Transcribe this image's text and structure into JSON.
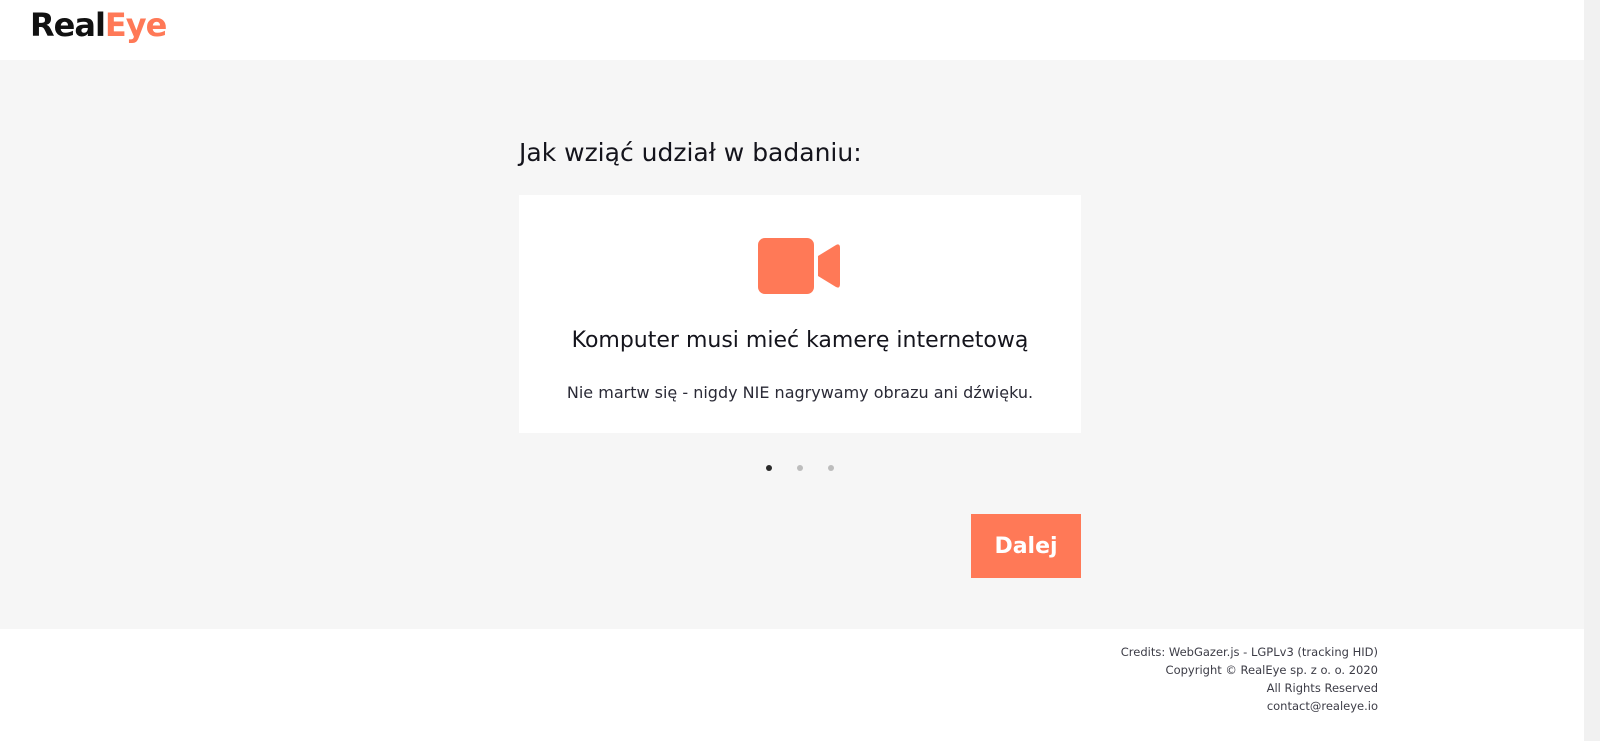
{
  "header": {
    "logo_part1": "Real",
    "logo_part2": "Eye"
  },
  "main": {
    "heading": "Jak wziąć udział w badaniu:",
    "card": {
      "icon": "video-camera-icon",
      "title": "Komputer musi mieć kamerę internetową",
      "text": "Nie martw się - nigdy NIE nagrywamy obrazu ani dźwięku."
    },
    "pagination": {
      "total": 3,
      "active": 1
    },
    "next_label": "Dalej"
  },
  "footer": {
    "credits": "Credits: WebGazer.js - LGPLv3 (tracking HID)",
    "copyright": "Copyright © RealEye sp. z o. o. 2020",
    "rights": "All Rights Reserved",
    "contact": "contact@realeye.io"
  },
  "colors": {
    "accent": "#ff7957",
    "background": "#f6f6f6",
    "text": "#14141c"
  }
}
